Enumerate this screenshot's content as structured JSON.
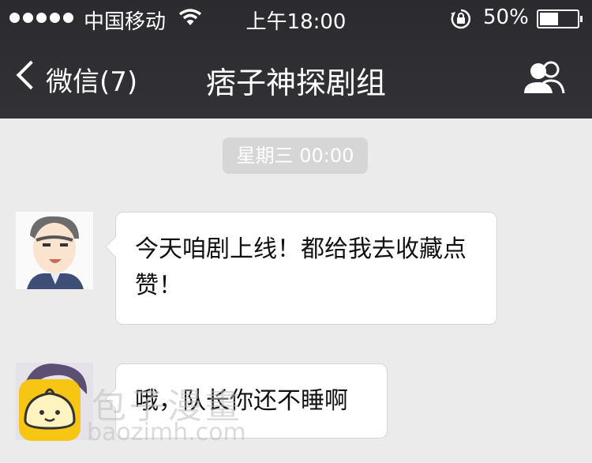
{
  "status_bar": {
    "carrier": "中国移动",
    "time": "上午18:00",
    "battery_percent": "50%",
    "battery_level": 0.5,
    "signal_dots": 5
  },
  "nav": {
    "back_label": "微信(7)",
    "title": "痞子神探剧组",
    "members_icon": "people-icon"
  },
  "chat": {
    "timestamp": "星期三 00:00",
    "messages": [
      {
        "sender": "avatar-officer",
        "text": "今天咱剧上线！都给我去收藏点赞！"
      },
      {
        "sender": "avatar-purple-hair",
        "text": "哦，队长你还不睡啊"
      }
    ]
  },
  "watermark": {
    "text": "包子漫畫",
    "url": "baozimh.com"
  },
  "colors": {
    "topbar": "#2b2b2f",
    "background": "#ebebeb",
    "bubble": "#ffffff",
    "timestamp_bg": "#d6d6d6",
    "watermark_logo": "#f7c514"
  }
}
